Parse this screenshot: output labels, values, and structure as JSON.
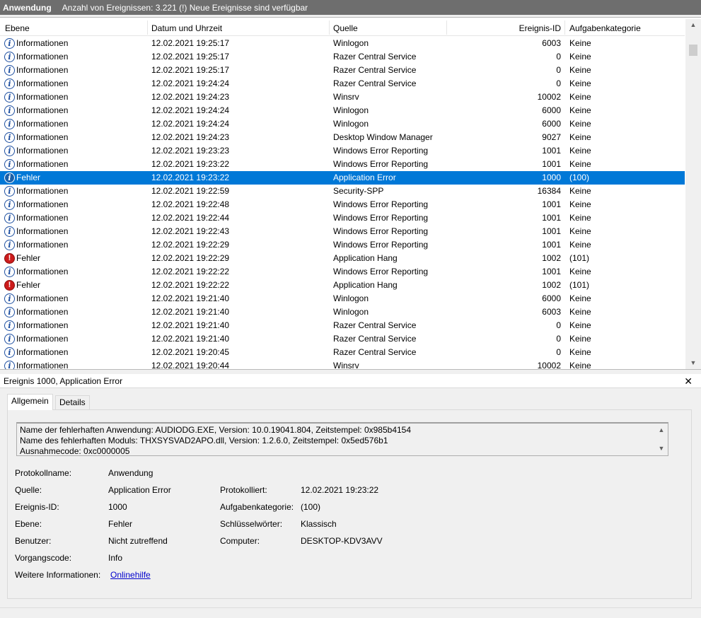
{
  "topbar": {
    "title": "Anwendung",
    "info": "Anzahl von Ereignissen: 3.221 (!) Neue Ereignisse sind verfügbar"
  },
  "columns": {
    "level": "Ebene",
    "date": "Datum und Uhrzeit",
    "source": "Quelle",
    "id": "Ereignis-ID",
    "category": "Aufgabenkategorie"
  },
  "events": [
    {
      "level": "Informationen",
      "type": "info",
      "date": "12.02.2021 19:25:17",
      "source": "Winlogon",
      "id": "6003",
      "category": "Keine"
    },
    {
      "level": "Informationen",
      "type": "info",
      "date": "12.02.2021 19:25:17",
      "source": "Razer Central Service",
      "id": "0",
      "category": "Keine"
    },
    {
      "level": "Informationen",
      "type": "info",
      "date": "12.02.2021 19:25:17",
      "source": "Razer Central Service",
      "id": "0",
      "category": "Keine"
    },
    {
      "level": "Informationen",
      "type": "info",
      "date": "12.02.2021 19:24:24",
      "source": "Razer Central Service",
      "id": "0",
      "category": "Keine"
    },
    {
      "level": "Informationen",
      "type": "info",
      "date": "12.02.2021 19:24:23",
      "source": "Winsrv",
      "id": "10002",
      "category": "Keine"
    },
    {
      "level": "Informationen",
      "type": "info",
      "date": "12.02.2021 19:24:24",
      "source": "Winlogon",
      "id": "6000",
      "category": "Keine"
    },
    {
      "level": "Informationen",
      "type": "info",
      "date": "12.02.2021 19:24:24",
      "source": "Winlogon",
      "id": "6000",
      "category": "Keine"
    },
    {
      "level": "Informationen",
      "type": "info",
      "date": "12.02.2021 19:24:23",
      "source": "Desktop Window Manager",
      "id": "9027",
      "category": "Keine"
    },
    {
      "level": "Informationen",
      "type": "info",
      "date": "12.02.2021 19:23:23",
      "source": "Windows Error Reporting",
      "id": "1001",
      "category": "Keine"
    },
    {
      "level": "Informationen",
      "type": "info",
      "date": "12.02.2021 19:23:22",
      "source": "Windows Error Reporting",
      "id": "1001",
      "category": "Keine"
    },
    {
      "level": "Fehler",
      "type": "info",
      "selected": true,
      "date": "12.02.2021 19:23:22",
      "source": "Application Error",
      "id": "1000",
      "category": "(100)"
    },
    {
      "level": "Informationen",
      "type": "info",
      "date": "12.02.2021 19:22:59",
      "source": "Security-SPP",
      "id": "16384",
      "category": "Keine"
    },
    {
      "level": "Informationen",
      "type": "info",
      "date": "12.02.2021 19:22:48",
      "source": "Windows Error Reporting",
      "id": "1001",
      "category": "Keine"
    },
    {
      "level": "Informationen",
      "type": "info",
      "date": "12.02.2021 19:22:44",
      "source": "Windows Error Reporting",
      "id": "1001",
      "category": "Keine"
    },
    {
      "level": "Informationen",
      "type": "info",
      "date": "12.02.2021 19:22:43",
      "source": "Windows Error Reporting",
      "id": "1001",
      "category": "Keine"
    },
    {
      "level": "Informationen",
      "type": "info",
      "date": "12.02.2021 19:22:29",
      "source": "Windows Error Reporting",
      "id": "1001",
      "category": "Keine"
    },
    {
      "level": "Fehler",
      "type": "error",
      "date": "12.02.2021 19:22:29",
      "source": "Application Hang",
      "id": "1002",
      "category": "(101)"
    },
    {
      "level": "Informationen",
      "type": "info",
      "date": "12.02.2021 19:22:22",
      "source": "Windows Error Reporting",
      "id": "1001",
      "category": "Keine"
    },
    {
      "level": "Fehler",
      "type": "error",
      "date": "12.02.2021 19:22:22",
      "source": "Application Hang",
      "id": "1002",
      "category": "(101)"
    },
    {
      "level": "Informationen",
      "type": "info",
      "date": "12.02.2021 19:21:40",
      "source": "Winlogon",
      "id": "6000",
      "category": "Keine"
    },
    {
      "level": "Informationen",
      "type": "info",
      "date": "12.02.2021 19:21:40",
      "source": "Winlogon",
      "id": "6003",
      "category": "Keine"
    },
    {
      "level": "Informationen",
      "type": "info",
      "date": "12.02.2021 19:21:40",
      "source": "Razer Central Service",
      "id": "0",
      "category": "Keine"
    },
    {
      "level": "Informationen",
      "type": "info",
      "date": "12.02.2021 19:21:40",
      "source": "Razer Central Service",
      "id": "0",
      "category": "Keine"
    },
    {
      "level": "Informationen",
      "type": "info",
      "date": "12.02.2021 19:20:45",
      "source": "Razer Central Service",
      "id": "0",
      "category": "Keine"
    },
    {
      "level": "Informationen",
      "type": "info",
      "date": "12.02.2021 19:20:44",
      "source": "Winsrv",
      "id": "10002",
      "category": "Keine"
    }
  ],
  "detail": {
    "header": "Ereignis 1000, Application Error",
    "tabs": [
      "Allgemein",
      "Details"
    ],
    "message_lines": [
      "Name der fehlerhaften Anwendung: AUDIODG.EXE, Version: 10.0.19041.804, Zeitstempel: 0x985b4154",
      "Name des fehlerhaften Moduls: THXSYSVAD2APO.dll, Version: 1.2.6.0, Zeitstempel: 0x5ed576b1",
      "Ausnahmecode: 0xc0000005"
    ],
    "fields": {
      "log_name_label": "Protokollname:",
      "log_name": "Anwendung",
      "source_label": "Quelle:",
      "source": "Application Error",
      "logged_label": "Protokolliert:",
      "logged": "12.02.2021 19:23:22",
      "event_id_label": "Ereignis-ID:",
      "event_id": "1000",
      "task_category_label": "Aufgabenkategorie:",
      "task_category": "(100)",
      "level_label": "Ebene:",
      "level": "Fehler",
      "keywords_label": "Schlüsselwörter:",
      "keywords": "Klassisch",
      "user_label": "Benutzer:",
      "user": "Nicht zutreffend",
      "computer_label": "Computer:",
      "computer": "DESKTOP-KDV3AVV",
      "opcode_label": "Vorgangscode:",
      "opcode": "Info",
      "more_info_label": "Weitere Informationen:",
      "more_info_link": "Onlinehilfe"
    }
  },
  "colors": {
    "selection": "#0078d7",
    "info_icon": "#1c4ea0",
    "error_icon": "#cc1b1b",
    "link": "#0000cc"
  },
  "icons": {
    "info": "information-icon",
    "error": "error-icon",
    "close": "close-icon"
  }
}
